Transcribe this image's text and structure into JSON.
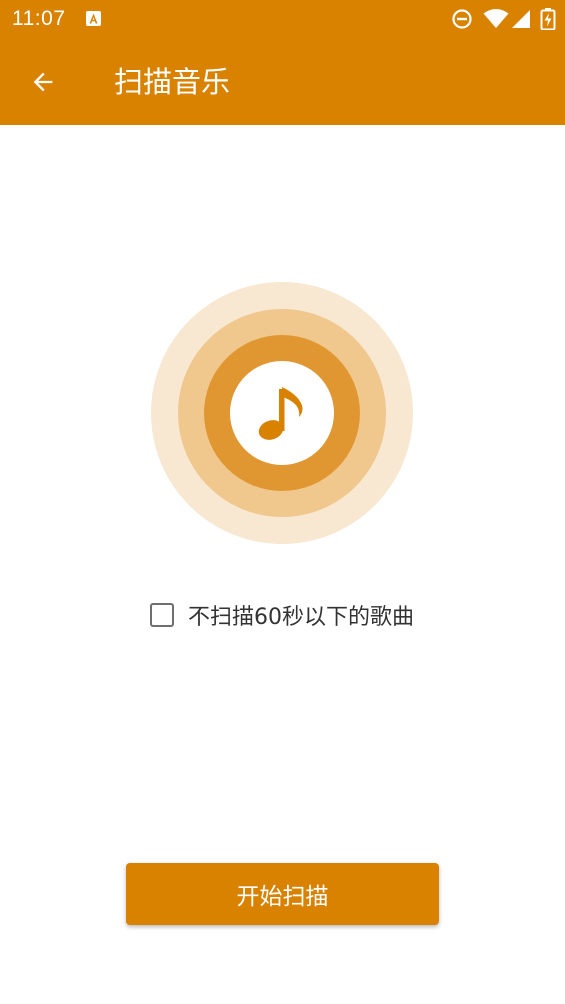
{
  "status_bar": {
    "time": "11:07",
    "icons": [
      "notification-a-icon",
      "do-not-disturb-icon",
      "wifi-icon",
      "signal-icon",
      "battery-charging-icon"
    ]
  },
  "app_bar": {
    "back_icon": "arrow-left-icon",
    "title": "扫描音乐"
  },
  "scan_graphic": {
    "icon": "music-note-icon"
  },
  "filter": {
    "label": "不扫描60秒以下的歌曲",
    "checked": false
  },
  "start_button": {
    "label": "开始扫描"
  },
  "colors": {
    "primary": "#D98200",
    "ring_outer": "#F8E7D1",
    "ring_middle": "#F0C88E",
    "ring_inner": "#E19731"
  }
}
